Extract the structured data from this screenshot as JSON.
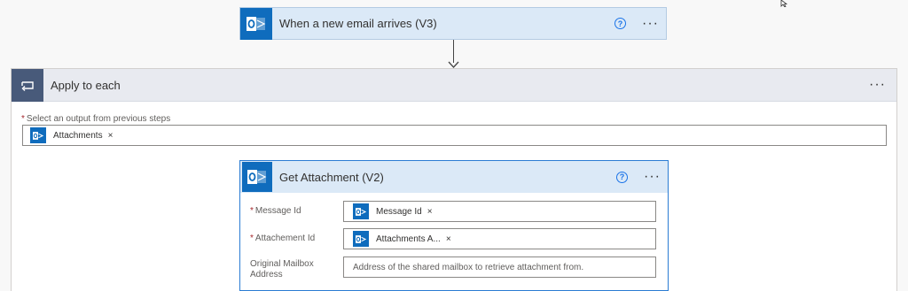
{
  "trigger": {
    "title": "When a new email arrives (V3)",
    "help_glyph": "?",
    "more_glyph": "···",
    "icon": "outlook-icon"
  },
  "apply_to_each": {
    "title": "Apply to each",
    "icon": "loop-icon",
    "more_glyph": "···",
    "select_label": "Select an output from previous steps",
    "required_mark": "*",
    "token": {
      "label": "Attachments",
      "remove_glyph": "×"
    }
  },
  "action": {
    "title": "Get Attachment (V2)",
    "help_glyph": "?",
    "more_glyph": "···",
    "fields": [
      {
        "label": "Message Id",
        "required": true,
        "token": "Message Id",
        "remove_glyph": "×"
      },
      {
        "label": "Attachement Id",
        "required": true,
        "token": "Attachments A...",
        "remove_glyph": "×"
      },
      {
        "label": "Original Mailbox Address",
        "required": false,
        "placeholder": "Address of the shared mailbox to retrieve attachment from."
      }
    ]
  },
  "colors": {
    "outlook_blue": "#0f6cbd",
    "loop_tile": "#485a7a",
    "card_header": "#dbe9f7",
    "required": "#a4262c",
    "help": "#1a73e8"
  }
}
